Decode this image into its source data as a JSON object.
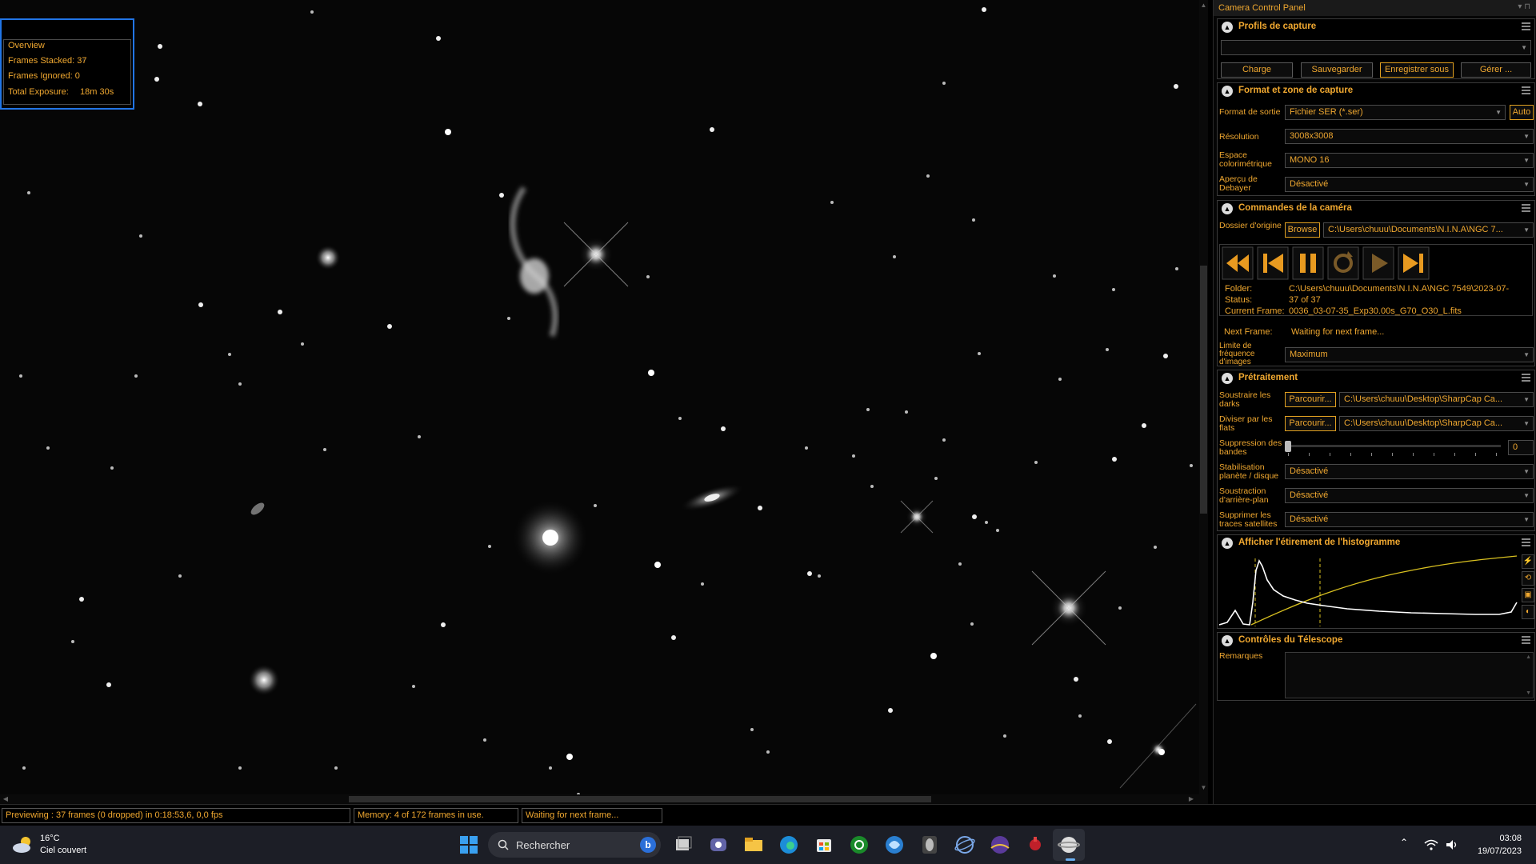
{
  "overview": {
    "title": "Overview",
    "frames_stacked": "Frames Stacked: 37",
    "frames_ignored": "Frames Ignored: 0",
    "total_exposure_label": "Total Exposure:",
    "total_exposure_value": "18m 30s"
  },
  "panel": {
    "title": "Camera Control Panel",
    "profiles": {
      "title": "Profils de capture",
      "selected_profile": "",
      "buttons": [
        "Charge",
        "Sauvegarder",
        "Enregistrer sous",
        "Gérer ..."
      ]
    },
    "format": {
      "title": "Format et zone de capture",
      "rows": [
        {
          "label": "Format de sortie",
          "value": "Fichier SER (*.ser)"
        },
        {
          "label": "Résolution",
          "value": "3008x3008"
        },
        {
          "label": "Espace colorimétrique",
          "value": "MONO 16"
        },
        {
          "label": "Aperçu de Debayer",
          "value": "Désactivé"
        }
      ],
      "auto_label": "Auto"
    },
    "camera": {
      "title": "Commandes de la caméra",
      "source_label": "Dossier d'origine",
      "browse_label": "Browse",
      "source_path": "C:\\Users\\chuuu\\Documents\\N.I.N.A\\NGC 7...",
      "info": [
        {
          "label": "Folder:",
          "value": "C:\\Users\\chuuu\\Documents\\N.I.N.A\\NGC 7549\\2023-07-"
        },
        {
          "label": "Status:",
          "value": "37 of 37"
        },
        {
          "label": "Current Frame:",
          "value": "0036_03-07-35_Exp30.00s_G70_O30_L.fits"
        },
        {
          "label": "Next Frame:",
          "value": "Waiting for next frame..."
        }
      ],
      "framerate_label": "Limite de fréquence d'images",
      "framerate_value": "Maximum"
    },
    "preprocess": {
      "title": "Prétraitement",
      "darks_label": "Soustraire les darks",
      "flats_label": "Diviser par les flats",
      "browse_label": "Parcourir...",
      "darks_path": "C:\\Users\\chuuu\\Desktop\\SharpCap Ca...",
      "flats_path": "C:\\Users\\chuuu\\Desktop\\SharpCap Ca...",
      "banding_label": "Suppression des bandes",
      "banding_value": "0",
      "rows": [
        {
          "label": "Stabilisation planète / disque",
          "value": "Désactivé"
        },
        {
          "label": "Soustraction d'arrière-plan",
          "value": "Désactivé"
        },
        {
          "label": "Supprimer les traces satellites",
          "value": "Désactivé"
        }
      ]
    },
    "histogram": {
      "title": "Afficher l'étirement de l'histogramme"
    },
    "telescope": {
      "title": "Contrôles du Télescope",
      "notes_label": "Remarques"
    }
  },
  "status_bar": {
    "preview": "Previewing : 37 frames (0 dropped) in 0:18:53,6, 0,0 fps",
    "memory": "Memory: 4 of 172 frames in use.",
    "waiting": "Waiting for next frame..."
  },
  "taskbar": {
    "temperature": "16°C",
    "weather": "Ciel couvert",
    "search_placeholder": "Rechercher",
    "time": "03:08",
    "date": "19/07/2023"
  },
  "colors": {
    "accent": "#f0a830",
    "overview_border": "#2175e6"
  }
}
